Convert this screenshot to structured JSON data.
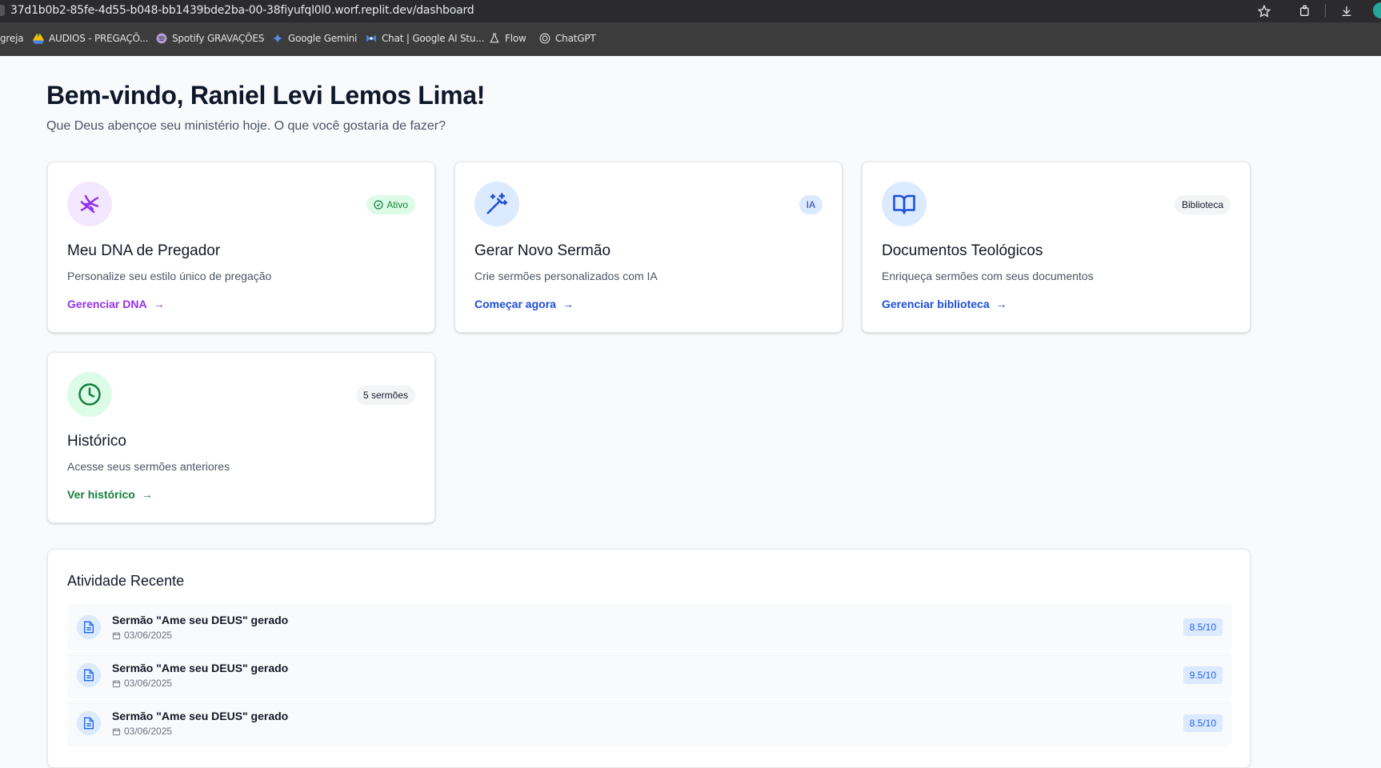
{
  "browser": {
    "url": "37d1b0b2-85fe-4d55-b048-bb1439bde2ba-00-38fiyufql0l0.worf.replit.dev/dashboard",
    "bookmarks": [
      {
        "label": "greja",
        "icon": "none"
      },
      {
        "label": "AUDIOS - PREGAÇÕ...",
        "icon": "google-drive-icon"
      },
      {
        "label": "Spotify GRAVAÇÕES",
        "icon": "spotify-icon"
      },
      {
        "label": "Google Gemini",
        "icon": "gemini-icon"
      },
      {
        "label": "Chat | Google AI Stu...",
        "icon": "ai-studio-icon"
      },
      {
        "label": "Flow",
        "icon": "flask-icon"
      },
      {
        "label": "ChatGPT",
        "icon": "chatgpt-icon"
      }
    ]
  },
  "header": {
    "welcome": "Bem-vindo, Raniel Levi Lemos Lima!",
    "subtitle": "Que Deus abençoe seu ministério hoje. O que você gostaria de fazer?"
  },
  "cards": [
    {
      "title": "Meu DNA de Pregador",
      "description": "Personalize seu estilo único de pregação",
      "badge": "Ativo",
      "link": "Gerenciar DNA",
      "icon": "dna-icon",
      "accent": "#9333ea",
      "icon_bg": "#f3e8ff",
      "badge_bg": "#dcfce7",
      "badge_color": "#15803d"
    },
    {
      "title": "Gerar Novo Sermão",
      "description": "Crie sermões personalizados com IA",
      "badge": "IA",
      "link": "Começar agora",
      "icon": "magic-wand-icon",
      "accent": "#1d4ed8",
      "icon_bg": "#dbeafe",
      "badge_bg": "#dbeafe",
      "badge_color": "#1e40af"
    },
    {
      "title": "Documentos Teológicos",
      "description": "Enriqueça sermões com seus documentos",
      "badge": "Biblioteca",
      "link": "Gerenciar biblioteca",
      "icon": "book-open-icon",
      "accent": "#1d4ed8",
      "icon_bg": "#dbeafe",
      "badge_bg": "#f3f4f6",
      "badge_color": "#111827"
    },
    {
      "title": "Histórico",
      "description": "Acesse seus sermões anteriores",
      "badge": "5 sermões",
      "link": "Ver histórico",
      "icon": "clock-icon",
      "accent": "#15803d",
      "icon_bg": "#dcfce7",
      "badge_bg": "#f3f4f6",
      "badge_color": "#111827"
    }
  ],
  "activity": {
    "title": "Atividade Recente",
    "items": [
      {
        "name": "Sermão \"Ame seu DEUS\" gerado",
        "date": "03/06/2025",
        "score": "8.5/10"
      },
      {
        "name": "Sermão \"Ame seu DEUS\" gerado",
        "date": "03/06/2025",
        "score": "9.5/10"
      },
      {
        "name": "Sermão \"Ame seu DEUS\" gerado",
        "date": "03/06/2025",
        "score": "8.5/10"
      }
    ]
  }
}
